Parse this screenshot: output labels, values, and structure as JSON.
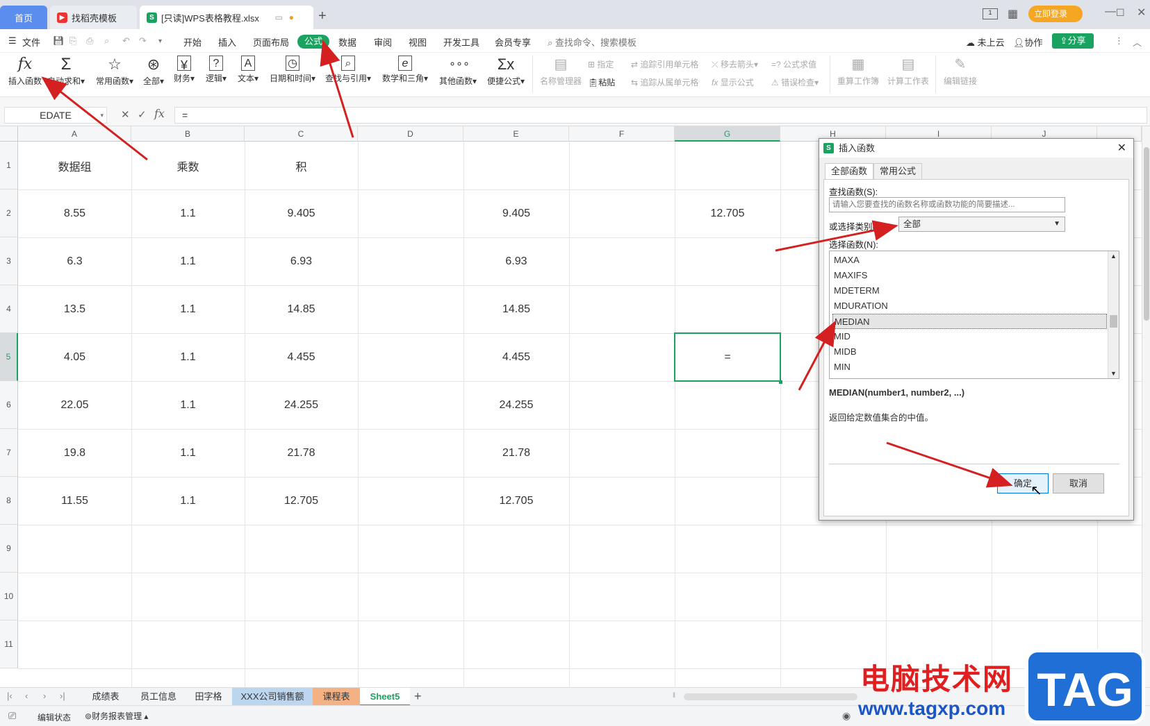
{
  "titlebar": {
    "tab_home": "首页",
    "tab_templates": "找稻壳模板",
    "tab_doc": "[只读]WPS表格教程.xlsx",
    "login": "立即登录",
    "add_tab": "+"
  },
  "menu": {
    "file": "文件",
    "items": [
      "开始",
      "插入",
      "页面布局",
      "公式",
      "数据",
      "审阅",
      "视图",
      "开发工具",
      "会员专享"
    ],
    "search": "查找命令、搜索模板",
    "cloud": "未上云",
    "collab": "协作",
    "share": "分享"
  },
  "ribbon": {
    "insert_fn": "插入函数",
    "autosum": "自动求和",
    "common_fn": "常用函数",
    "all": "全部",
    "finance": "财务",
    "logic": "逻辑",
    "text": "文本",
    "datetime": "日期和时间",
    "lookup": "查找与引用",
    "math": "数学和三角",
    "other": "其他函数",
    "quick": "便捷公式",
    "name_mgr": "名称管理器",
    "specify": "指定",
    "paste": "粘贴",
    "trace_prec": "追踪引用单元格",
    "trace_dep": "追踪从属单元格",
    "remove_arrows": "移去箭头",
    "show_formula": "显示公式",
    "eval": "公式求值",
    "err_check": "错误检查",
    "recalc": "重算工作簿",
    "calc_sheet": "计算工作表",
    "edit_links": "编辑链接"
  },
  "formula_bar": {
    "name_box": "EDATE",
    "fx": "fx",
    "value": "="
  },
  "grid": {
    "columns": [
      "A",
      "B",
      "C",
      "D",
      "E",
      "F",
      "G",
      "H",
      "I",
      "J"
    ],
    "rows": [
      "1",
      "2",
      "3",
      "4",
      "5",
      "6",
      "7",
      "8",
      "9",
      "10",
      "11"
    ],
    "header_row": [
      "数据组",
      "乘数",
      "积"
    ],
    "col_a": [
      "8.55",
      "6.3",
      "13.5",
      "4.05",
      "22.05",
      "19.8",
      "11.55"
    ],
    "col_b": [
      "1.1",
      "1.1",
      "1.1",
      "1.1",
      "1.1",
      "1.1",
      "1.1"
    ],
    "col_c": [
      "9.405",
      "6.93",
      "14.85",
      "4.455",
      "24.255",
      "21.78",
      "12.705"
    ],
    "col_e": [
      "9.405",
      "6.93",
      "14.85",
      "4.455",
      "24.255",
      "21.78",
      "12.705"
    ],
    "g2": "12.705",
    "g5": "="
  },
  "sheets": {
    "tabs": [
      "成绩表",
      "员工信息",
      "田字格",
      "XXX公司销售额",
      "课程表",
      "Sheet5"
    ],
    "active": "Sheet5",
    "add": "+"
  },
  "status": {
    "edit_state": "编辑状态",
    "finance_report": "财务报表管理"
  },
  "dialog": {
    "title": "插入函数",
    "tab_all": "全部函数",
    "tab_common": "常用公式",
    "search_label": "查找函数(S):",
    "search_placeholder": "请输入您要查找的函数名称或函数功能的简要描述...",
    "category_label": "或选择类别(C):",
    "category_value": "全部",
    "select_label": "选择函数(N):",
    "functions": [
      "MAXA",
      "MAXIFS",
      "MDETERM",
      "MDURATION",
      "MEDIAN",
      "MID",
      "MIDB",
      "MIN"
    ],
    "selected": "MEDIAN",
    "signature": "MEDIAN(number1, number2, ...)",
    "description": "返回给定数值集合的中值。",
    "ok": "确定",
    "cancel": "取消"
  },
  "watermark": {
    "text": "电脑技术网",
    "url": "www.tagxp.com",
    "tag": "TAG"
  },
  "colors": {
    "accent_green": "#1aa260",
    "arrow_red": "#d42020",
    "selection_green": "#1aa260",
    "home_tab_blue": "#5b8def"
  }
}
